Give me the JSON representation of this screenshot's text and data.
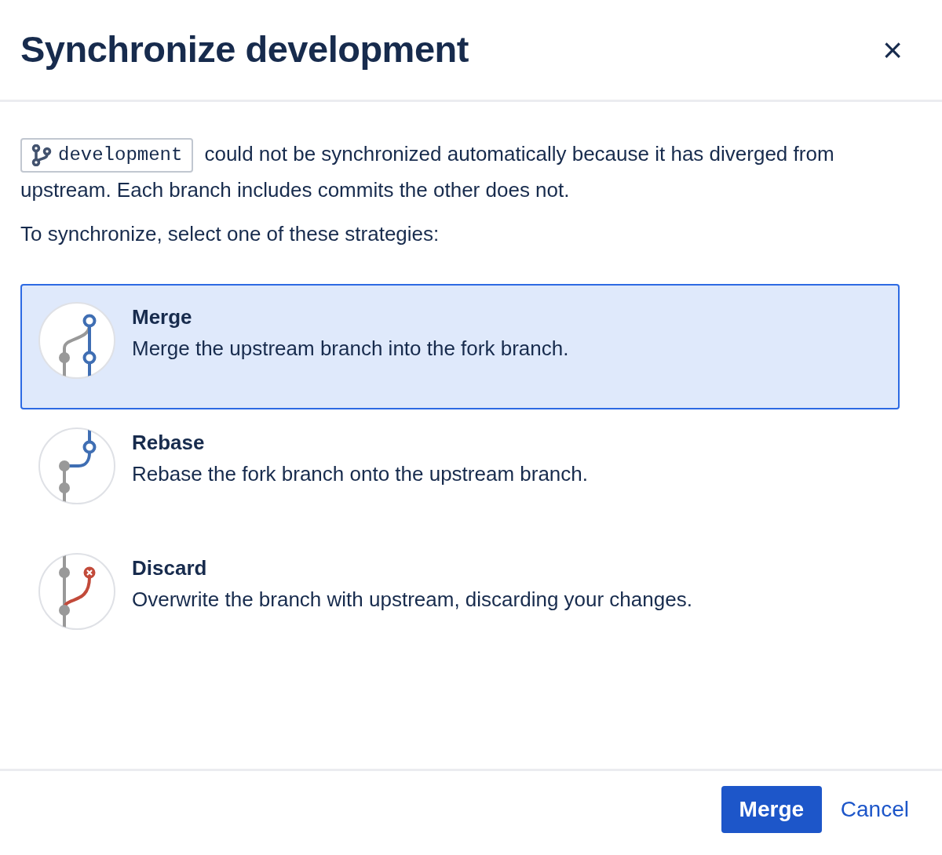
{
  "dialog": {
    "title": "Synchronize development",
    "close": "×"
  },
  "message": {
    "branch": "development",
    "text": "could not be synchronized automatically because it has diverged from upstream. Each branch includes commits the other does not."
  },
  "prompt": "To synchronize, select one of these strategies:",
  "options": [
    {
      "kind": "merge",
      "title": "Merge",
      "description": "Merge the upstream branch into the fork branch.",
      "selected": true
    },
    {
      "kind": "rebase",
      "title": "Rebase",
      "description": "Rebase the fork branch onto the upstream branch.",
      "selected": false
    },
    {
      "kind": "discard",
      "title": "Discard",
      "description": "Overwrite the branch with upstream, discarding your changes.",
      "selected": false
    }
  ],
  "buttons": {
    "primary": "Merge",
    "cancel": "Cancel"
  }
}
